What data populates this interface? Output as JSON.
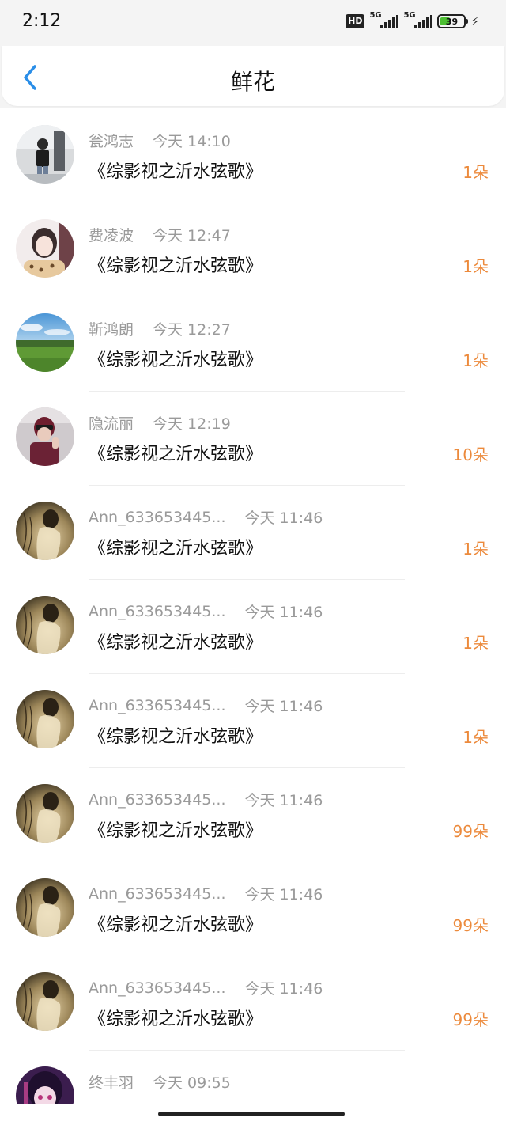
{
  "status": {
    "time": "2:12",
    "hd": "HD",
    "signal1": "5G",
    "signal2": "5G",
    "battery": "39",
    "battery_color": "#4cbf32"
  },
  "header": {
    "title": "鲜花",
    "accent": "#2a8ee8"
  },
  "colors": {
    "count": "#ec8a3c",
    "meta": "#9a9a9a"
  },
  "items": [
    {
      "name": "瓮鸿志",
      "time": "今天 14:10",
      "work": "《综影视之沂水弦歌》",
      "count": "1朵",
      "avatar": "photo-boy"
    },
    {
      "name": "费凌波",
      "time": "今天 12:47",
      "work": "《综影视之沂水弦歌》",
      "count": "1朵",
      "avatar": "photo-girl"
    },
    {
      "name": "靳鸿朗",
      "time": "今天 12:27",
      "work": "《综影视之沂水弦歌》",
      "count": "1朵",
      "avatar": "photo-landscape"
    },
    {
      "name": "隐流丽",
      "time": "今天 12:19",
      "work": "《综影视之沂水弦歌》",
      "count": "10朵",
      "avatar": "photo-man"
    },
    {
      "name": "Ann_633653445...",
      "time": "今天 11:46",
      "work": "《综影视之沂水弦歌》",
      "count": "1朵",
      "avatar": "photo-sepia"
    },
    {
      "name": "Ann_633653445...",
      "time": "今天 11:46",
      "work": "《综影视之沂水弦歌》",
      "count": "1朵",
      "avatar": "photo-sepia"
    },
    {
      "name": "Ann_633653445...",
      "time": "今天 11:46",
      "work": "《综影视之沂水弦歌》",
      "count": "1朵",
      "avatar": "photo-sepia"
    },
    {
      "name": "Ann_633653445...",
      "time": "今天 11:46",
      "work": "《综影视之沂水弦歌》",
      "count": "99朵",
      "avatar": "photo-sepia"
    },
    {
      "name": "Ann_633653445...",
      "time": "今天 11:46",
      "work": "《综影视之沂水弦歌》",
      "count": "99朵",
      "avatar": "photo-sepia"
    },
    {
      "name": "Ann_633653445...",
      "time": "今天 11:46",
      "work": "《综影视之沂水弦歌》",
      "count": "99朵",
      "avatar": "photo-sepia"
    },
    {
      "name": "终丰羽",
      "time": "今天 09:55",
      "work": "《综影视之沂水弦歌》",
      "count": "",
      "avatar": "photo-anime"
    }
  ]
}
